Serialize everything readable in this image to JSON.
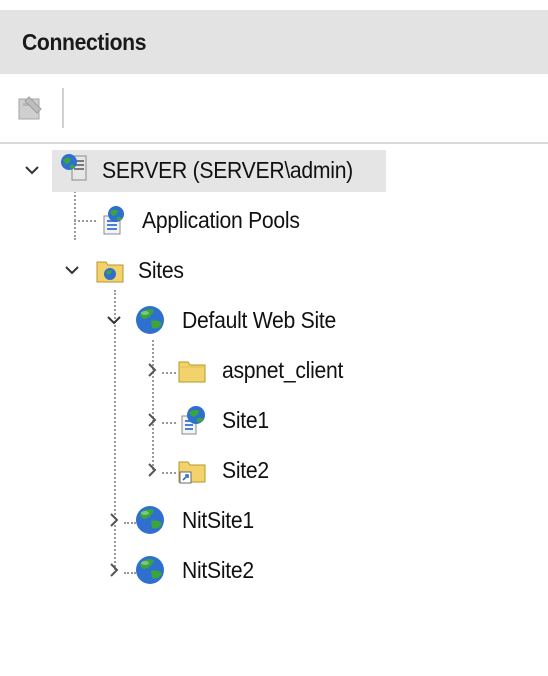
{
  "panel": {
    "title": "Connections"
  },
  "toolbar": {
    "buttons": [
      {
        "icon": "new-connection-icon"
      }
    ]
  },
  "tree": {
    "server": {
      "label": "SERVER (SERVER\\admin)",
      "expanded": true,
      "selected": true
    },
    "app_pools": {
      "label": "Application Pools"
    },
    "sites": {
      "label": "Sites",
      "expanded": true
    },
    "default_site": {
      "label": "Default Web Site",
      "expanded": true
    },
    "aspnet_client": {
      "label": "aspnet_client",
      "expanded": false
    },
    "site1": {
      "label": "Site1",
      "expanded": false
    },
    "site2": {
      "label": "Site2",
      "expanded": false
    },
    "nitsite1": {
      "label": "NitSite1",
      "expanded": false
    },
    "nitsite2": {
      "label": "NitSite2",
      "expanded": false
    }
  },
  "colors": {
    "header_bg": "#e3e3e3",
    "selection_bg": "#e5e5e5",
    "globe_green": "#3aa63a",
    "globe_blue": "#2f6fd0",
    "folder_yellow": "#f2d36b"
  }
}
